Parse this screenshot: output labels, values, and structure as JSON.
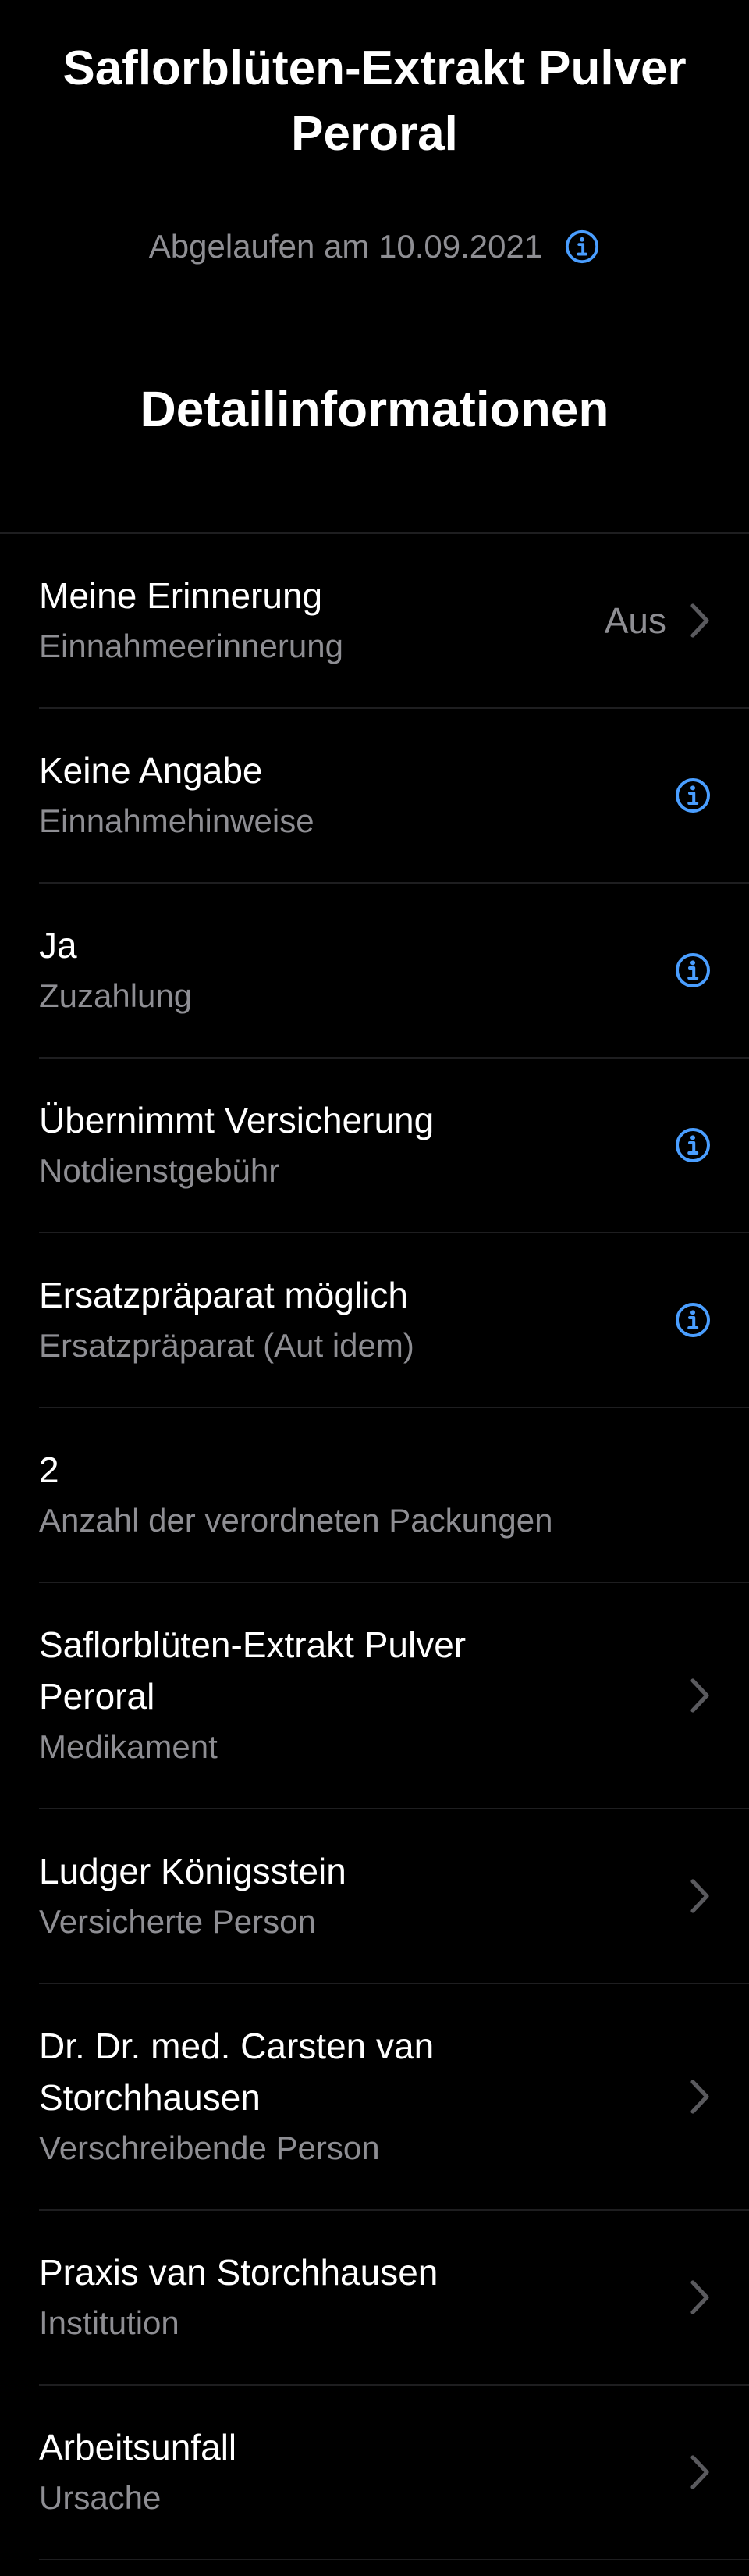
{
  "header": {
    "title": "Saflorblüten-Extrakt Pulver Peroral",
    "status": "Abgelaufen am 10.09.2021"
  },
  "section": {
    "title": "Detailinformationen"
  },
  "rows": [
    {
      "value": "Meine Erinnerung",
      "label": "Einnahmeerinnerung",
      "trailing_text": "Aus"
    },
    {
      "value": "Keine Angabe",
      "label": "Einnahmehinweise"
    },
    {
      "value": "Ja",
      "label": "Zuzahlung"
    },
    {
      "value": "Übernimmt Versicherung",
      "label": "Notdienstgebühr"
    },
    {
      "value": "Ersatzpräparat möglich",
      "label": "Ersatzpräparat (Aut idem)"
    },
    {
      "value": "2",
      "label": "Anzahl der verordneten Packungen"
    },
    {
      "value": "Saflorblüten-Extrakt Pulver Peroral",
      "label": "Medikament"
    },
    {
      "value": "Ludger Königsstein",
      "label": "Versicherte Person"
    },
    {
      "value": "Dr. Dr. med. Carsten van Storchhausen",
      "label": "Verschreibende Person"
    },
    {
      "value": "Praxis van Storchhausen",
      "label": "Institution"
    },
    {
      "value": "Arbeitsunfall",
      "label": "Ursache"
    }
  ],
  "colors": {
    "background": "#000000",
    "accent": "#4a9eff",
    "secondary_text": "#8e8e93",
    "separator": "#1e1e20",
    "chevron": "#5a5a5e"
  },
  "icons": {
    "info": "info-circle-icon",
    "chevron": "chevron-right-icon"
  }
}
